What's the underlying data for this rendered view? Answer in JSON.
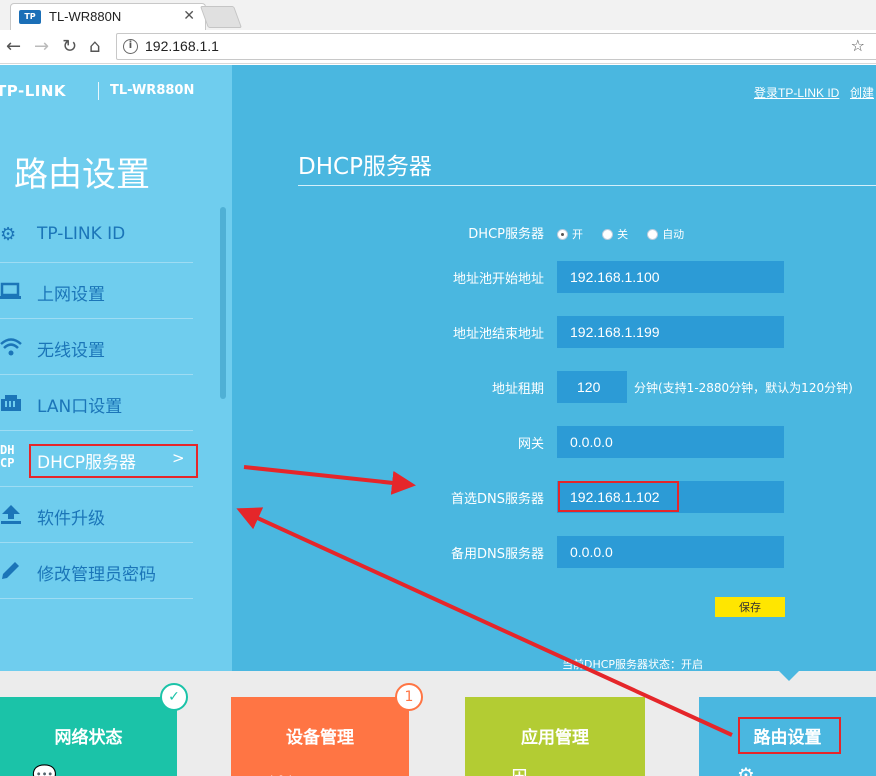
{
  "browser": {
    "tab_title": "TL-WR880N",
    "tab_favicon_text": "TP",
    "url": "192.168.1.1"
  },
  "sidebar": {
    "brand": "TP-LINK",
    "model": "TL-WR880N",
    "title": "路由设置",
    "items": [
      {
        "label": "TP-LINK ID",
        "icon": "gear-icon"
      },
      {
        "label": "上网设置",
        "icon": "laptop-icon"
      },
      {
        "label": "无线设置",
        "icon": "wifi-icon"
      },
      {
        "label": "LAN口设置",
        "icon": "lan-port-icon"
      },
      {
        "label": "DHCP服务器",
        "icon": "dhcp-icon",
        "active": true,
        "arrow": ">"
      },
      {
        "label": "软件升级",
        "icon": "upload-icon"
      },
      {
        "label": "修改管理员密码",
        "icon": "pencil-icon"
      }
    ],
    "dhcp_icon_text": "DH\nCP"
  },
  "header": {
    "login_link": "登录TP-LINK ID",
    "create_link": "创建"
  },
  "dhcp": {
    "title": "DHCP服务器",
    "server_label": "DHCP服务器",
    "radio_on": "开",
    "radio_off": "关",
    "radio_auto": "自动",
    "selected": "开",
    "start_label": "地址池开始地址",
    "start_value": "192.168.1.100",
    "end_label": "地址池结束地址",
    "end_value": "192.168.1.199",
    "lease_label": "地址租期",
    "lease_value": "120",
    "lease_hint": "分钟(支持1-2880分钟，默认为120分钟)",
    "gateway_label": "网关",
    "gateway_value": "0.0.0.0",
    "dns1_label": "首选DNS服务器",
    "dns1_value": "192.168.1.102",
    "dns2_label": "备用DNS服务器",
    "dns2_value": "0.0.0.0",
    "save_label": "保存",
    "status": "当前DHCP服务器状态：开启"
  },
  "tiles": [
    {
      "label": "网络状态",
      "color": "#1bc3a8",
      "badge": "✓"
    },
    {
      "label": "设备管理",
      "color": "#ff7544",
      "badge": "1"
    },
    {
      "label": "应用管理",
      "color": "#b3cc33",
      "badge": ""
    },
    {
      "label": "路由设置",
      "color": "#4ab7e0",
      "badge": ""
    }
  ],
  "colors": {
    "sidebar": "#6fcdee",
    "main": "#4ab7e0",
    "field": "#2c9bd6",
    "save": "#ffe600",
    "annotation": "#e5262a"
  }
}
